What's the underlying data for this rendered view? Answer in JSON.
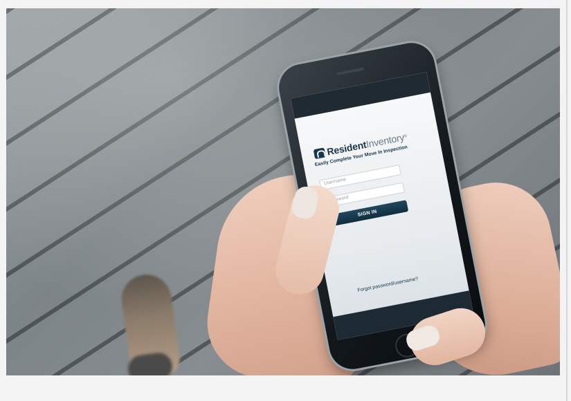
{
  "photo": {
    "background": "wooden-deck",
    "accent_colors": {
      "brand_dark": "#17364a",
      "brand_gray": "#6c7a83",
      "button": "#0f2d3f"
    }
  },
  "app": {
    "logo": {
      "word_primary": "Resident",
      "word_secondary": "Inventory",
      "trademark": "®",
      "icon": "house-logo-icon"
    },
    "tagline": "Easily Complete Your Move In Inspection",
    "username_placeholder": "Username",
    "password_placeholder": "Password",
    "signin_label": "SIGN IN",
    "forgot_label": "Forgot password/username?"
  }
}
